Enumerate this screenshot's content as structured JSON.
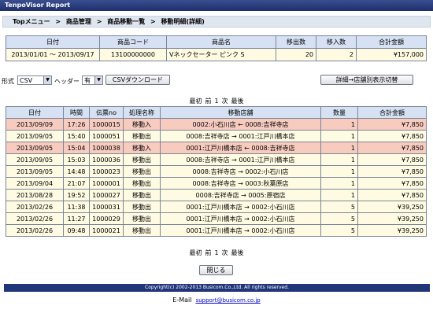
{
  "app_title": "TenpoVisor Report",
  "breadcrumb": [
    "Topメニュー",
    ">",
    "商品管理",
    ">",
    "商品移動一覧",
    ">",
    "移動明細(詳細)"
  ],
  "summary": {
    "headers": [
      "日付",
      "商品コード",
      "商品名",
      "移出数",
      "移入数",
      "合計金額"
    ],
    "row": [
      "2013/01/01 ～ 2013/09/17",
      "13100000000",
      "Vネックセーター ピンク S",
      "20",
      "2",
      "¥157,000"
    ]
  },
  "toolbar": {
    "format_label": "形式",
    "format_value": "CSV",
    "header_label": "ヘッダー",
    "header_value": "有",
    "csv_button": "CSVダウンロード",
    "toggle_button": "詳細→店舗別表示切替"
  },
  "pager": [
    "最初",
    "前",
    "1",
    "次",
    "最後"
  ],
  "detail": {
    "headers": [
      "日付",
      "時間",
      "伝票no",
      "処理名称",
      "移動店舗",
      "数量",
      "合計金額"
    ],
    "rows": [
      {
        "date": "2013/09/09",
        "time": "17:26",
        "slip": "1000015",
        "proc": "移動入",
        "store": "0002:小石川店 ← 0008:吉祥寺店",
        "qty": "1",
        "amount": "¥7,850",
        "hl": true
      },
      {
        "date": "2013/09/05",
        "time": "15:40",
        "slip": "1000051",
        "proc": "移動出",
        "store": "0008:吉祥寺店 → 0001:江戸川橋本店",
        "qty": "1",
        "amount": "¥7,850",
        "hl": false
      },
      {
        "date": "2013/09/05",
        "time": "15:04",
        "slip": "1000038",
        "proc": "移動入",
        "store": "0001:江戸川橋本店 ← 0008:吉祥寺店",
        "qty": "1",
        "amount": "¥7,850",
        "hl": true
      },
      {
        "date": "2013/09/05",
        "time": "15:03",
        "slip": "1000036",
        "proc": "移動出",
        "store": "0008:吉祥寺店 → 0001:江戸川橋本店",
        "qty": "1",
        "amount": "¥7,850",
        "hl": false
      },
      {
        "date": "2013/09/05",
        "time": "14:48",
        "time2": "",
        "slip": "1000023",
        "proc": "移動出",
        "store": "0008:吉祥寺店 → 0002:小石川店",
        "qty": "1",
        "amount": "¥7,850",
        "hl": false
      },
      {
        "date": "2013/09/04",
        "time": "21:07",
        "slip": "1000001",
        "proc": "移動出",
        "store": "0008:吉祥寺店 → 0003:秋葉原店",
        "qty": "1",
        "amount": "¥7,850",
        "hl": false
      },
      {
        "date": "2013/08/28",
        "time": "19:52",
        "slip": "1000027",
        "proc": "移動出",
        "store": "0008:吉祥寺店 → 0005:原宿店",
        "qty": "1",
        "amount": "¥7,850",
        "hl": false
      },
      {
        "date": "2013/02/26",
        "time": "11:38",
        "slip": "1000031",
        "proc": "移動出",
        "store": "0001:江戸川橋本店 → 0002:小石川店",
        "qty": "5",
        "amount": "¥39,250",
        "hl": false
      },
      {
        "date": "2013/02/26",
        "time": "11:27",
        "slip": "1000029",
        "proc": "移動出",
        "store": "0001:江戸川橋本店 → 0002:小石川店",
        "qty": "5",
        "amount": "¥39,250",
        "hl": false
      },
      {
        "date": "2013/02/26",
        "time": "09:48",
        "slip": "1000021",
        "proc": "移動出",
        "store": "0001:江戸川橋本店 → 0002:小石川店",
        "qty": "5",
        "amount": "¥39,250",
        "hl": false
      }
    ]
  },
  "close_button": "閉じる",
  "copyright": "Copyright(c) 2002-2013 Busicom.Co.,Ltd. All rights reserved.",
  "email_label": "E-Mail",
  "email_link": "support@busicom.co.jp"
}
